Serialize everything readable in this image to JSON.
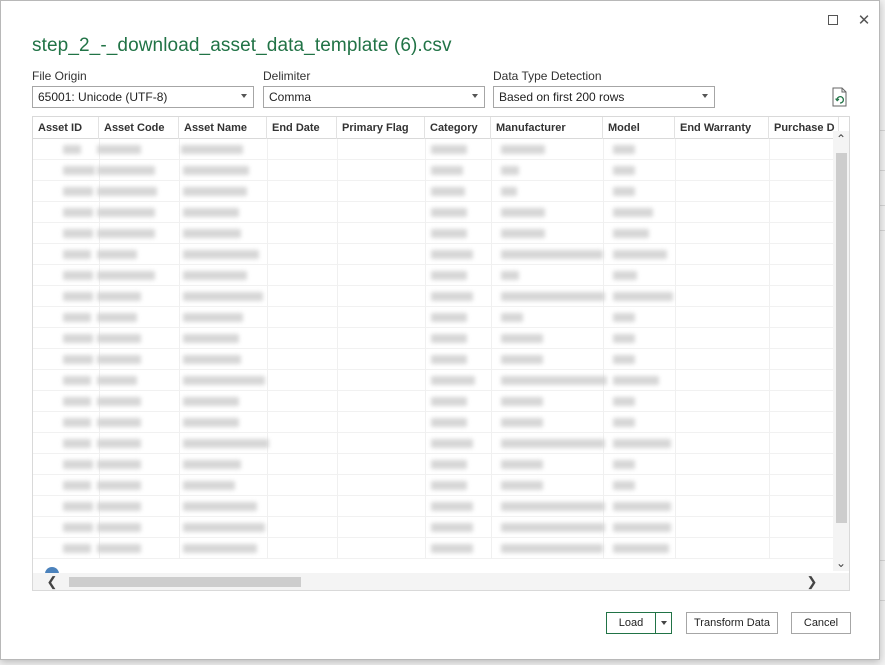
{
  "dialog": {
    "title": "step_2_-_download_asset_data_template (6).csv",
    "close_glyph": "✕"
  },
  "options": {
    "file_origin": {
      "label": "File Origin",
      "value": "65001: Unicode (UTF-8)"
    },
    "delimiter": {
      "label": "Delimiter",
      "value": "Comma"
    },
    "data_type_detection": {
      "label": "Data Type Detection",
      "value": "Based on first 200 rows"
    }
  },
  "table": {
    "columns": [
      "Asset ID",
      "Asset Code",
      "Asset Name",
      "End Date",
      "Primary Flag",
      "Category",
      "Manufacturer",
      "Model",
      "End Warranty",
      "Purchase D"
    ]
  },
  "scroll": {
    "up_glyph": "⌃",
    "down_glyph": "⌄",
    "left_glyph": "❮",
    "right_glyph": "❯"
  },
  "buttons": {
    "load": "Load",
    "transform": "Transform Data",
    "cancel": "Cancel"
  },
  "icons": {
    "maximize": "maximize-icon",
    "close": "close-icon",
    "refresh": "refresh-file-icon",
    "dropdown": "chevron-down-icon"
  },
  "colors": {
    "accent": "#217346"
  }
}
